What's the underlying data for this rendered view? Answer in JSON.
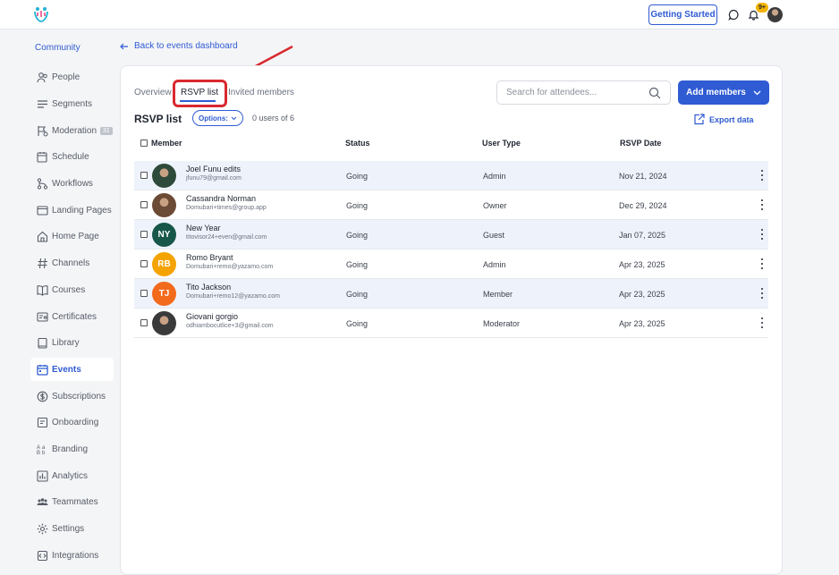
{
  "topbar": {
    "getting_started": "Getting Started",
    "notification_count": "9+"
  },
  "sidebar": {
    "title": "Community",
    "items": [
      {
        "label": "People",
        "icon": "people-icon"
      },
      {
        "label": "Segments",
        "icon": "segments-icon"
      },
      {
        "label": "Moderation",
        "icon": "moderation-icon",
        "count": "31"
      },
      {
        "label": "Schedule",
        "icon": "schedule-icon"
      },
      {
        "label": "Workflows",
        "icon": "workflows-icon"
      },
      {
        "label": "Landing Pages",
        "icon": "landing-pages-icon"
      },
      {
        "label": "Home Page",
        "icon": "home-icon"
      },
      {
        "label": "Channels",
        "icon": "hash-icon"
      },
      {
        "label": "Courses",
        "icon": "book-icon"
      },
      {
        "label": "Certificates",
        "icon": "certificate-icon"
      },
      {
        "label": "Library",
        "icon": "library-icon"
      },
      {
        "label": "Events",
        "icon": "calendar-icon",
        "active": true
      },
      {
        "label": "Subscriptions",
        "icon": "subscriptions-icon"
      },
      {
        "label": "Onboarding",
        "icon": "onboarding-icon"
      },
      {
        "label": "Branding",
        "icon": "branding-icon"
      },
      {
        "label": "Analytics",
        "icon": "analytics-icon"
      },
      {
        "label": "Teammates",
        "icon": "teammates-icon"
      },
      {
        "label": "Settings",
        "icon": "gear-icon"
      },
      {
        "label": "Integrations",
        "icon": "integrations-icon"
      }
    ]
  },
  "back_link": "Back to events dashboard",
  "tabs": {
    "overview": "Overview",
    "rsvp": "RSVP list",
    "invited": "Invited members"
  },
  "search": {
    "placeholder": "Search for attendees..."
  },
  "add_members": "Add members",
  "list": {
    "title": "RSVP list",
    "options": "Options:",
    "users_count": "0 users of 6",
    "export": "Export data"
  },
  "table": {
    "headers": {
      "member": "Member",
      "status": "Status",
      "user_type": "User Type",
      "rsvp_date": "RSVP Date"
    },
    "rows": [
      {
        "name": "Joel Funu edits",
        "email": "jfunu79@gmail.com",
        "status": "Going",
        "user_type": "Admin",
        "date": "Nov 21, 2024",
        "initials": "",
        "avatar_color": "#2e4a3a"
      },
      {
        "name": "Cassandra Norman",
        "email": "Domubari+times@group.app",
        "status": "Going",
        "user_type": "Owner",
        "date": "Dec 29, 2024",
        "initials": "",
        "avatar_color": "#6b4a36"
      },
      {
        "name": "New Year",
        "email": "titovisor24+even@gmail.com",
        "status": "Going",
        "user_type": "Guest",
        "date": "Jan 07, 2025",
        "initials": "NY",
        "avatar_color": "#17574a"
      },
      {
        "name": "Romo Bryant",
        "email": "Domubari+remo@yazamo.com",
        "status": "Going",
        "user_type": "Admin",
        "date": "Apr 23, 2025",
        "initials": "RB",
        "avatar_color": "#f5a300"
      },
      {
        "name": "Tito Jackson",
        "email": "Domubari+remo12@yazamo.com",
        "status": "Going",
        "user_type": "Member",
        "date": "Apr 23, 2025",
        "initials": "TJ",
        "avatar_color": "#f26a1b"
      },
      {
        "name": "Giovani gorgio",
        "email": "odhiambocutlice+3@gmail.com",
        "status": "Going",
        "user_type": "Moderator",
        "date": "Apr 23, 2025",
        "initials": "",
        "avatar_color": "#3a3a3a"
      }
    ]
  },
  "colors": {
    "accent": "#2f5bd3",
    "highlight": "#d9282f"
  }
}
